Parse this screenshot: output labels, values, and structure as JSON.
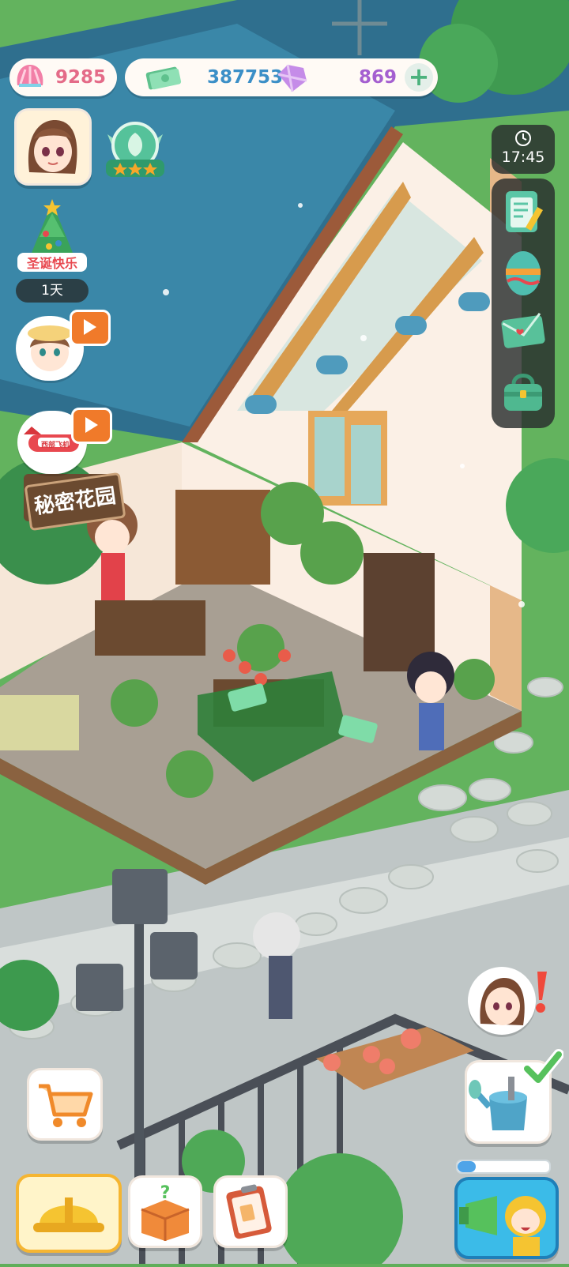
{
  "resources": {
    "shells": "9285",
    "cash": "387753",
    "gems": "869",
    "add_symbol": "+"
  },
  "clock": {
    "time": "17:45"
  },
  "event": {
    "days_left": "1天",
    "badge_text": "圣诞快乐"
  },
  "shop_sign": "秘密花园",
  "ad_tag": "西部飞机",
  "colors": {
    "pill_bg": "#fffaf5",
    "shell_text": "#e46b88",
    "cash_text": "#3b8fc7",
    "gem_text": "#a45fd0",
    "accent_yellow": "#f5c431",
    "panel_dark": "#2e3333"
  },
  "icons": {
    "shell": "shell-icon",
    "cash": "cash-icon",
    "gem": "gem-icon",
    "clock": "clock-icon",
    "tasks": "clipboard-pencil-icon",
    "egg": "easter-egg-icon",
    "mail": "envelope-icon",
    "bag": "bag-icon",
    "cart": "shopping-cart-icon",
    "build": "hardhat-icon",
    "mystery": "mystery-box-icon",
    "orders": "order-clipboard-icon",
    "water": "watering-can-icon",
    "promo": "megaphone-icon"
  }
}
